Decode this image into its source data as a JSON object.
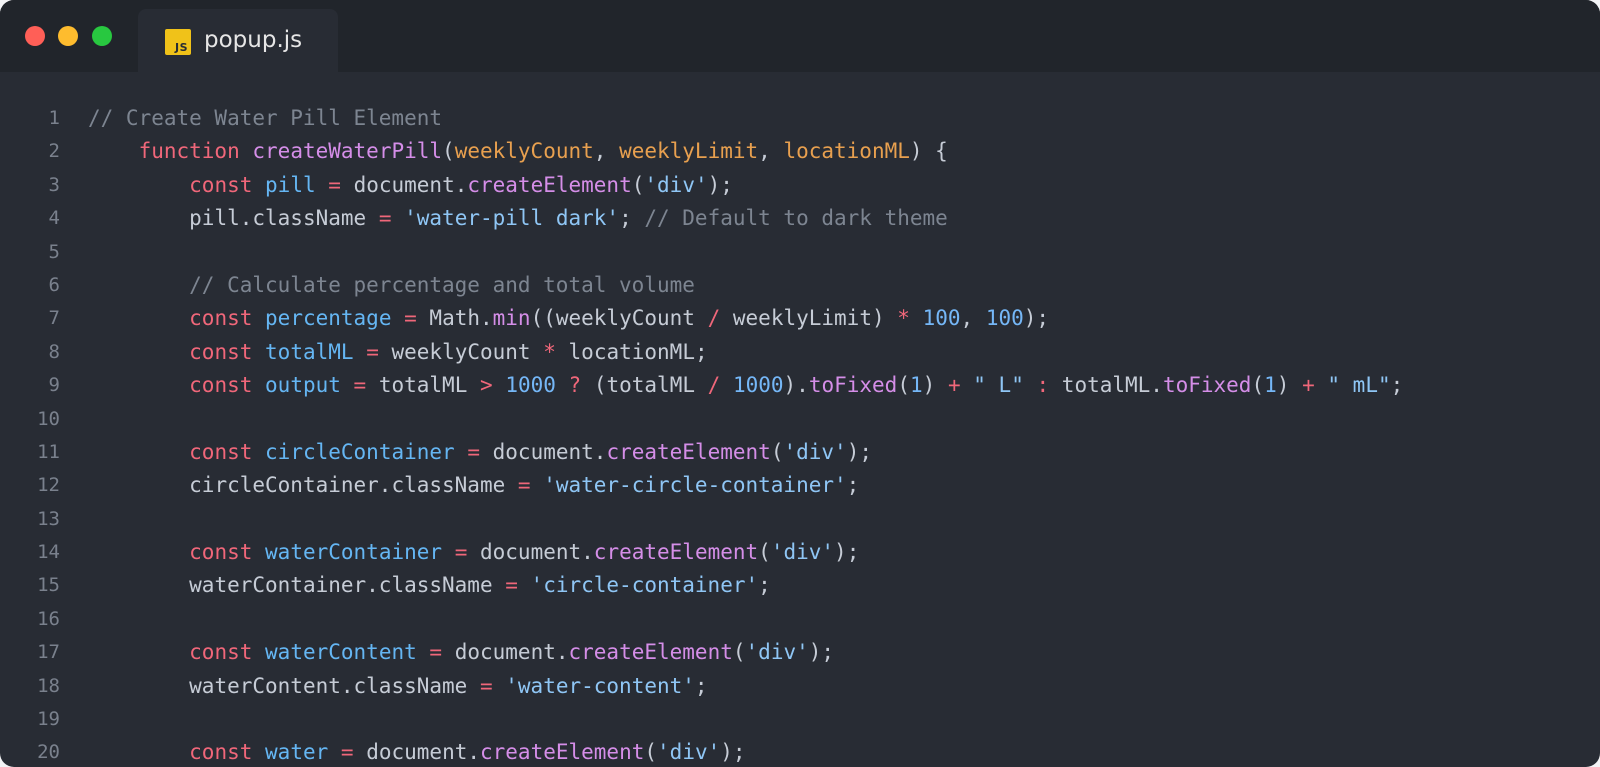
{
  "window": {
    "tab_title": "popup.js",
    "file_icon_label": "JS",
    "file_icon": "javascript-file-icon",
    "traffic_lights": [
      "#ff5f57",
      "#febc2e",
      "#28c840"
    ]
  },
  "colors": {
    "background": "#282c34",
    "titlebar": "#21252b",
    "keyword": "#f0677a",
    "function": "#d58ee8",
    "parameter": "#e8a04f",
    "variable": "#65b6f3",
    "string": "#8fc6f5",
    "comment": "#7d8591",
    "text": "#c6ccd6"
  },
  "code": {
    "lines": [
      {
        "num": "1",
        "indent": "",
        "tokens": [
          [
            "// Create Water Pill Element",
            "c"
          ]
        ]
      },
      {
        "num": "2",
        "indent": "    ",
        "tokens": [
          [
            "function",
            "k"
          ],
          [
            " ",
            "d"
          ],
          [
            "createWaterPill",
            "f"
          ],
          [
            "(",
            "d"
          ],
          [
            "weeklyCount",
            "p"
          ],
          [
            ", ",
            "d"
          ],
          [
            "weeklyLimit",
            "p"
          ],
          [
            ", ",
            "d"
          ],
          [
            "locationML",
            "p"
          ],
          [
            ") {",
            "d"
          ]
        ]
      },
      {
        "num": "3",
        "indent": "        ",
        "tokens": [
          [
            "const",
            "k"
          ],
          [
            " ",
            "d"
          ],
          [
            "pill",
            "v"
          ],
          [
            " ",
            "d"
          ],
          [
            "=",
            "k"
          ],
          [
            " document.",
            "d"
          ],
          [
            "createElement",
            "f"
          ],
          [
            "(",
            "d"
          ],
          [
            "'div'",
            "s"
          ],
          [
            ");",
            "d"
          ]
        ]
      },
      {
        "num": "4",
        "indent": "        ",
        "tokens": [
          [
            "pill.className ",
            "d"
          ],
          [
            "=",
            "k"
          ],
          [
            " ",
            "d"
          ],
          [
            "'water-pill dark'",
            "s"
          ],
          [
            "; ",
            "d"
          ],
          [
            "// Default to dark theme",
            "c"
          ]
        ]
      },
      {
        "num": "5",
        "indent": "",
        "tokens": []
      },
      {
        "num": "6",
        "indent": "        ",
        "tokens": [
          [
            "// Calculate percentage and total volume",
            "c"
          ]
        ]
      },
      {
        "num": "7",
        "indent": "        ",
        "tokens": [
          [
            "const",
            "k"
          ],
          [
            " ",
            "d"
          ],
          [
            "percentage",
            "v"
          ],
          [
            " ",
            "d"
          ],
          [
            "=",
            "k"
          ],
          [
            " Math.",
            "d"
          ],
          [
            "min",
            "f"
          ],
          [
            "((weeklyCount ",
            "d"
          ],
          [
            "/",
            "k"
          ],
          [
            " weeklyLimit) ",
            "d"
          ],
          [
            "*",
            "k"
          ],
          [
            " ",
            "d"
          ],
          [
            "100",
            "n"
          ],
          [
            ", ",
            "d"
          ],
          [
            "100",
            "n"
          ],
          [
            ");",
            "d"
          ]
        ]
      },
      {
        "num": "8",
        "indent": "        ",
        "tokens": [
          [
            "const",
            "k"
          ],
          [
            " ",
            "d"
          ],
          [
            "totalML",
            "v"
          ],
          [
            " ",
            "d"
          ],
          [
            "=",
            "k"
          ],
          [
            " weeklyCount ",
            "d"
          ],
          [
            "*",
            "k"
          ],
          [
            " locationML;",
            "d"
          ]
        ]
      },
      {
        "num": "9",
        "indent": "        ",
        "tokens": [
          [
            "const",
            "k"
          ],
          [
            " ",
            "d"
          ],
          [
            "output",
            "v"
          ],
          [
            " ",
            "d"
          ],
          [
            "=",
            "k"
          ],
          [
            " totalML ",
            "d"
          ],
          [
            ">",
            "k"
          ],
          [
            " ",
            "d"
          ],
          [
            "1000",
            "n"
          ],
          [
            " ",
            "d"
          ],
          [
            "?",
            "k"
          ],
          [
            " (totalML ",
            "d"
          ],
          [
            "/",
            "k"
          ],
          [
            " ",
            "d"
          ],
          [
            "1000",
            "n"
          ],
          [
            ").",
            "d"
          ],
          [
            "toFixed",
            "f"
          ],
          [
            "(",
            "d"
          ],
          [
            "1",
            "n"
          ],
          [
            ") ",
            "d"
          ],
          [
            "+",
            "k"
          ],
          [
            " ",
            "d"
          ],
          [
            "\" L\"",
            "s"
          ],
          [
            " ",
            "d"
          ],
          [
            ":",
            "k"
          ],
          [
            " totalML.",
            "d"
          ],
          [
            "toFixed",
            "f"
          ],
          [
            "(",
            "d"
          ],
          [
            "1",
            "n"
          ],
          [
            ") ",
            "d"
          ],
          [
            "+",
            "k"
          ],
          [
            " ",
            "d"
          ],
          [
            "\" mL\"",
            "s"
          ],
          [
            ";",
            "d"
          ]
        ]
      },
      {
        "num": "10",
        "indent": "",
        "tokens": []
      },
      {
        "num": "11",
        "indent": "        ",
        "tokens": [
          [
            "const",
            "k"
          ],
          [
            " ",
            "d"
          ],
          [
            "circleContainer",
            "v"
          ],
          [
            " ",
            "d"
          ],
          [
            "=",
            "k"
          ],
          [
            " document.",
            "d"
          ],
          [
            "createElement",
            "f"
          ],
          [
            "(",
            "d"
          ],
          [
            "'div'",
            "s"
          ],
          [
            ");",
            "d"
          ]
        ]
      },
      {
        "num": "12",
        "indent": "        ",
        "tokens": [
          [
            "circleContainer.className ",
            "d"
          ],
          [
            "=",
            "k"
          ],
          [
            " ",
            "d"
          ],
          [
            "'water-circle-container'",
            "s"
          ],
          [
            ";",
            "d"
          ]
        ]
      },
      {
        "num": "13",
        "indent": "",
        "tokens": []
      },
      {
        "num": "14",
        "indent": "        ",
        "tokens": [
          [
            "const",
            "k"
          ],
          [
            " ",
            "d"
          ],
          [
            "waterContainer",
            "v"
          ],
          [
            " ",
            "d"
          ],
          [
            "=",
            "k"
          ],
          [
            " document.",
            "d"
          ],
          [
            "createElement",
            "f"
          ],
          [
            "(",
            "d"
          ],
          [
            "'div'",
            "s"
          ],
          [
            ");",
            "d"
          ]
        ]
      },
      {
        "num": "15",
        "indent": "        ",
        "tokens": [
          [
            "waterContainer.className ",
            "d"
          ],
          [
            "=",
            "k"
          ],
          [
            " ",
            "d"
          ],
          [
            "'circle-container'",
            "s"
          ],
          [
            ";",
            "d"
          ]
        ]
      },
      {
        "num": "16",
        "indent": "",
        "tokens": []
      },
      {
        "num": "17",
        "indent": "        ",
        "tokens": [
          [
            "const",
            "k"
          ],
          [
            " ",
            "d"
          ],
          [
            "waterContent",
            "v"
          ],
          [
            " ",
            "d"
          ],
          [
            "=",
            "k"
          ],
          [
            " document.",
            "d"
          ],
          [
            "createElement",
            "f"
          ],
          [
            "(",
            "d"
          ],
          [
            "'div'",
            "s"
          ],
          [
            ");",
            "d"
          ]
        ]
      },
      {
        "num": "18",
        "indent": "        ",
        "tokens": [
          [
            "waterContent.className ",
            "d"
          ],
          [
            "=",
            "k"
          ],
          [
            " ",
            "d"
          ],
          [
            "'water-content'",
            "s"
          ],
          [
            ";",
            "d"
          ]
        ]
      },
      {
        "num": "19",
        "indent": "",
        "tokens": []
      },
      {
        "num": "20",
        "indent": "        ",
        "tokens": [
          [
            "const",
            "k"
          ],
          [
            " ",
            "d"
          ],
          [
            "water",
            "v"
          ],
          [
            " ",
            "d"
          ],
          [
            "=",
            "k"
          ],
          [
            " document.",
            "d"
          ],
          [
            "createElement",
            "f"
          ],
          [
            "(",
            "d"
          ],
          [
            "'div'",
            "s"
          ],
          [
            ");",
            "d"
          ]
        ]
      }
    ]
  }
}
